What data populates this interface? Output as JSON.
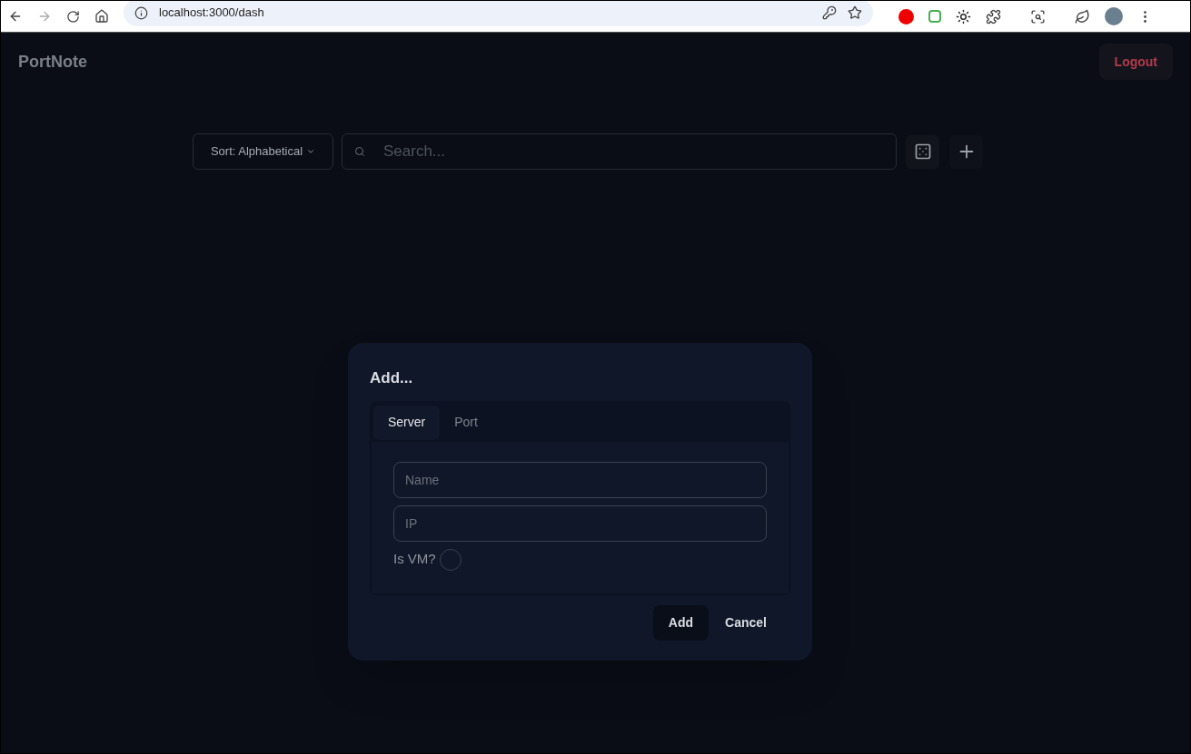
{
  "browser": {
    "url": "localhost:3000/dash"
  },
  "header": {
    "title": "PortNote",
    "logout": "Logout"
  },
  "toolbar": {
    "sort": "Sort: Alphabetical",
    "search": {
      "placeholder": "Search..."
    }
  },
  "dialog": {
    "title": "Add...",
    "tabs": [
      {
        "label": "Server",
        "selected": true
      },
      {
        "label": "Port",
        "selected": false
      }
    ],
    "fields": [
      {
        "placeholder": "Name"
      },
      {
        "placeholder": "IP"
      }
    ],
    "checkbox": {
      "label": "Is VM?",
      "checked": false
    },
    "buttons": [
      {
        "label": "Add",
        "kind": "filled"
      },
      {
        "label": "Cancel",
        "kind": "ghost"
      }
    ]
  }
}
